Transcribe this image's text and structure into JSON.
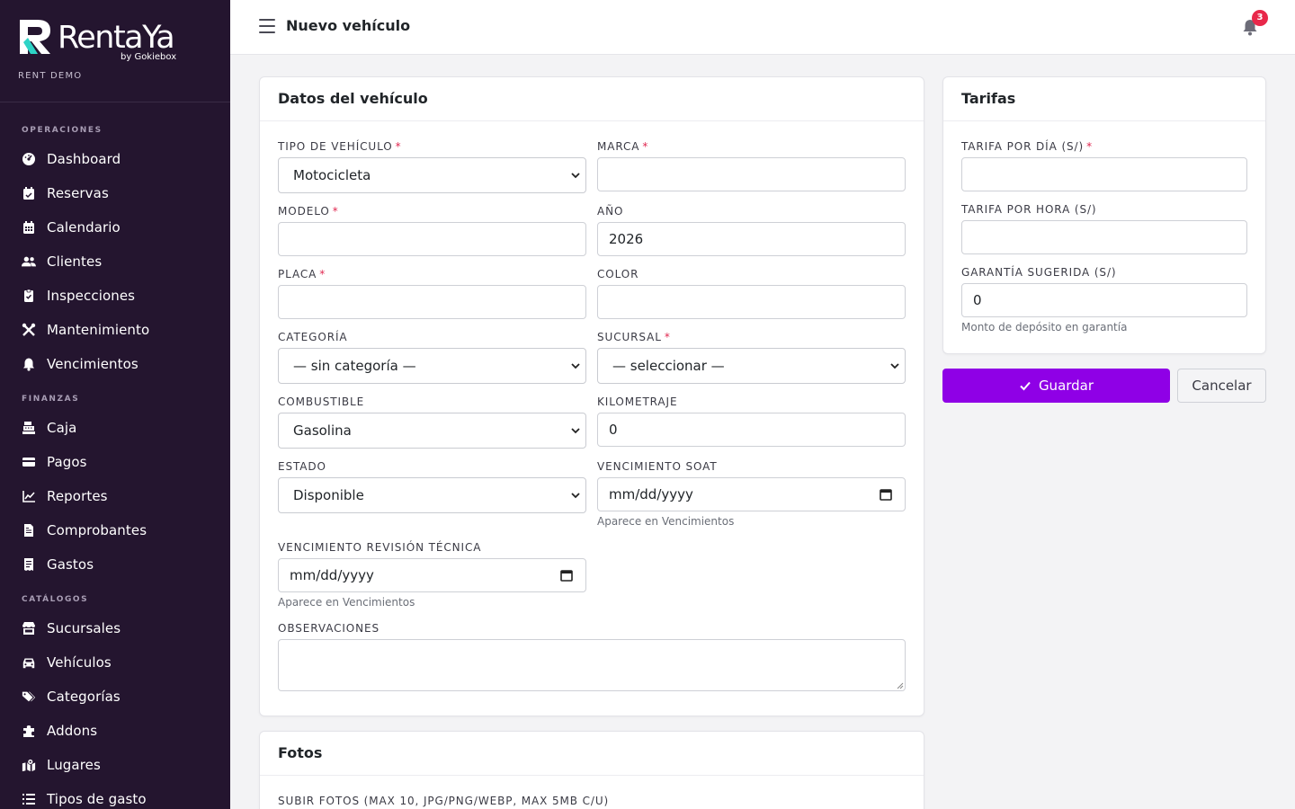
{
  "brand": {
    "name": "RentaYa",
    "sub": "by Gokiebox",
    "tenant": "RENT DEMO"
  },
  "sidebar": {
    "sections": [
      {
        "title": "OPERACIONES",
        "items": [
          {
            "label": "Dashboard",
            "icon": "dashboard-icon"
          },
          {
            "label": "Reservas",
            "icon": "calendar-check-icon"
          },
          {
            "label": "Calendario",
            "icon": "calendar-icon"
          },
          {
            "label": "Clientes",
            "icon": "users-icon"
          },
          {
            "label": "Inspecciones",
            "icon": "clipboard-check-icon"
          },
          {
            "label": "Mantenimiento",
            "icon": "tools-icon"
          },
          {
            "label": "Vencimientos",
            "icon": "bell-icon"
          }
        ]
      },
      {
        "title": "FINANZAS",
        "items": [
          {
            "label": "Caja",
            "icon": "cash-register-icon"
          },
          {
            "label": "Pagos",
            "icon": "credit-card-icon"
          },
          {
            "label": "Reportes",
            "icon": "line-chart-icon"
          },
          {
            "label": "Comprobantes",
            "icon": "invoice-icon"
          },
          {
            "label": "Gastos",
            "icon": "receipt-icon"
          }
        ]
      },
      {
        "title": "CATÁLOGOS",
        "items": [
          {
            "label": "Sucursales",
            "icon": "store-icon"
          },
          {
            "label": "Vehículos",
            "icon": "car-icon"
          },
          {
            "label": "Categorías",
            "icon": "tags-icon"
          },
          {
            "label": "Addons",
            "icon": "puzzle-icon"
          },
          {
            "label": "Lugares",
            "icon": "map-location-icon"
          },
          {
            "label": "Tipos de gasto",
            "icon": "list-icon"
          }
        ]
      }
    ]
  },
  "topbar": {
    "title": "Nuevo vehículo",
    "notifications": "3"
  },
  "vehicle_card": {
    "title": "Datos del vehículo",
    "tipo": {
      "label": "TIPO DE VEHÍCULO",
      "value": "Motocicleta"
    },
    "marca": {
      "label": "MARCA",
      "value": ""
    },
    "modelo": {
      "label": "MODELO",
      "value": ""
    },
    "anio": {
      "label": "AÑO",
      "value": "2026"
    },
    "placa": {
      "label": "PLACA",
      "value": ""
    },
    "color": {
      "label": "COLOR",
      "value": ""
    },
    "categoria": {
      "label": "CATEGORÍA",
      "value": "— sin categoría —"
    },
    "sucursal": {
      "label": "SUCURSAL",
      "value": "— seleccionar —"
    },
    "combustible": {
      "label": "COMBUSTIBLE",
      "value": "Gasolina"
    },
    "kilometraje": {
      "label": "KILOMETRAJE",
      "value": "0"
    },
    "estado": {
      "label": "ESTADO",
      "value": "Disponible"
    },
    "soat": {
      "label": "VENCIMIENTO SOAT",
      "placeholder": "mm/dd/yyyy",
      "help": "Aparece en Vencimientos"
    },
    "revision": {
      "label": "VENCIMIENTO REVISIÓN TÉCNICA",
      "placeholder": "mm/dd/yyyy",
      "help": "Aparece en Vencimientos"
    },
    "observaciones": {
      "label": "OBSERVACIONES",
      "value": ""
    },
    "required_mark": "*"
  },
  "photos_card": {
    "title": "Fotos",
    "upload_label": "SUBIR FOTOS (MAX 10, JPG/PNG/WEBP, MAX 5MB C/U)"
  },
  "tarifas_card": {
    "title": "Tarifas",
    "por_dia": {
      "label": "TARIFA POR DÍA (S/)",
      "value": ""
    },
    "por_hora": {
      "label": "TARIFA POR HORA (S/)",
      "value": ""
    },
    "garantia": {
      "label": "GARANTÍA SUGERIDA (S/)",
      "value": "0",
      "help": "Monto de depósito en garantía"
    }
  },
  "actions": {
    "save": "Guardar",
    "cancel": "Cancelar"
  },
  "colors": {
    "sidebar_bg": "#24152f",
    "accent": "#8f00e6",
    "required": "#e02850",
    "badge": "#e8284a"
  }
}
